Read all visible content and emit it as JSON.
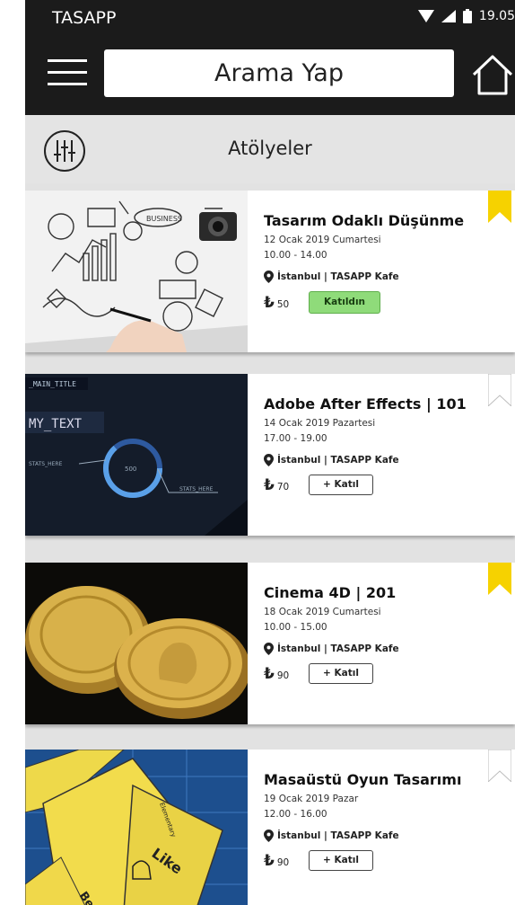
{
  "status_bar": {
    "app_name": "TASAPP",
    "time": "19.05"
  },
  "header": {
    "search_text": "Arama Yap"
  },
  "section": {
    "title": "Atölyeler"
  },
  "colors": {
    "bar": "#1b1b1b",
    "bookmark": "#f6d200",
    "joined_button": "#8fdb7a"
  },
  "workshops": [
    {
      "title": "Tasarım Odaklı Düşünme",
      "date": "12 Ocak 2019 Cumartesi",
      "time": "10.00 - 14.00",
      "location": "İstanbul | TASAPP Kafe",
      "currency": "₺",
      "price": "50",
      "action_label": "Katıldın",
      "joined": true,
      "bookmarked": true
    },
    {
      "title": "Adobe After Effects | 101",
      "date": "14 Ocak 2019 Pazartesi",
      "time": "17.00 - 19.00",
      "location": "İstanbul | TASAPP Kafe",
      "currency": "₺",
      "price": "70",
      "action_label": "+ Katıl",
      "joined": false,
      "bookmarked": false
    },
    {
      "title": "Cinema 4D | 201",
      "date": "18 Ocak 2019 Cumartesi",
      "time": "10.00 - 15.00",
      "location": "İstanbul | TASAPP Kafe",
      "currency": "₺",
      "price": "90",
      "action_label": "+ Katıl",
      "joined": false,
      "bookmarked": true
    },
    {
      "title": "Masaüstü Oyun Tasarımı",
      "date": "19 Ocak 2019 Pazar",
      "time": "12.00 - 16.00",
      "location": "İstanbul | TASAPP Kafe",
      "currency": "₺",
      "price": "90",
      "action_label": "+ Katıl",
      "joined": false,
      "bookmarked": false
    }
  ],
  "thumb_texts": {
    "sketch": "BUSINESS",
    "ae_main": "_MAIN_TITLE",
    "ae_text": "MY_TEXT",
    "ae_stats": "STATS_HERE",
    "ae_num": "500",
    "game_like": "Like",
    "game_begen": "Beğen",
    "game_elem": "Elementary"
  }
}
